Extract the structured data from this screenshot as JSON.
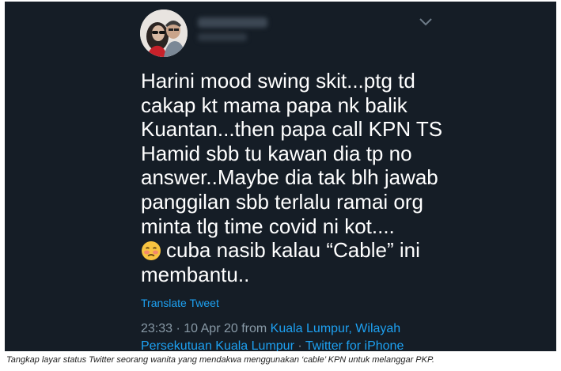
{
  "tweet": {
    "avatar_icon": "profile-photo",
    "menu_icon": "chevron-down-icon",
    "body_lines": [
      "Harini mood swing skit...ptg td",
      "cakap kt mama papa nk balik",
      "Kuantan...then papa call KPN TS",
      "Hamid sbb tu kawan dia tp no",
      "answer..Maybe dia tak blh jawab",
      "panggilan sbb terlalu ramai org",
      "minta tlg time covid ni kot...."
    ],
    "emoji_icon": "flushed-face-emoji",
    "body_line_after_emoji": "cuba nasib kalau “Cable” ini",
    "body_last_line": "membantu..",
    "translate_label": "Translate Tweet",
    "timestamp": "23:33 · 10 Apr 20 from",
    "location_part1": "Kuala Lumpur, Wilayah",
    "location_part2": "Persekutuan Kuala Lumpur",
    "separator": " · ",
    "source": "Twitter for iPhone"
  },
  "caption": "Tangkap layar status Twitter seorang wanita yang mendakwa menggunakan ‘cable’ KPN untuk melanggar PKP.",
  "colors": {
    "background": "#151d26",
    "text": "#ffffff",
    "link": "#1da1f2",
    "meta": "#8899a6"
  }
}
